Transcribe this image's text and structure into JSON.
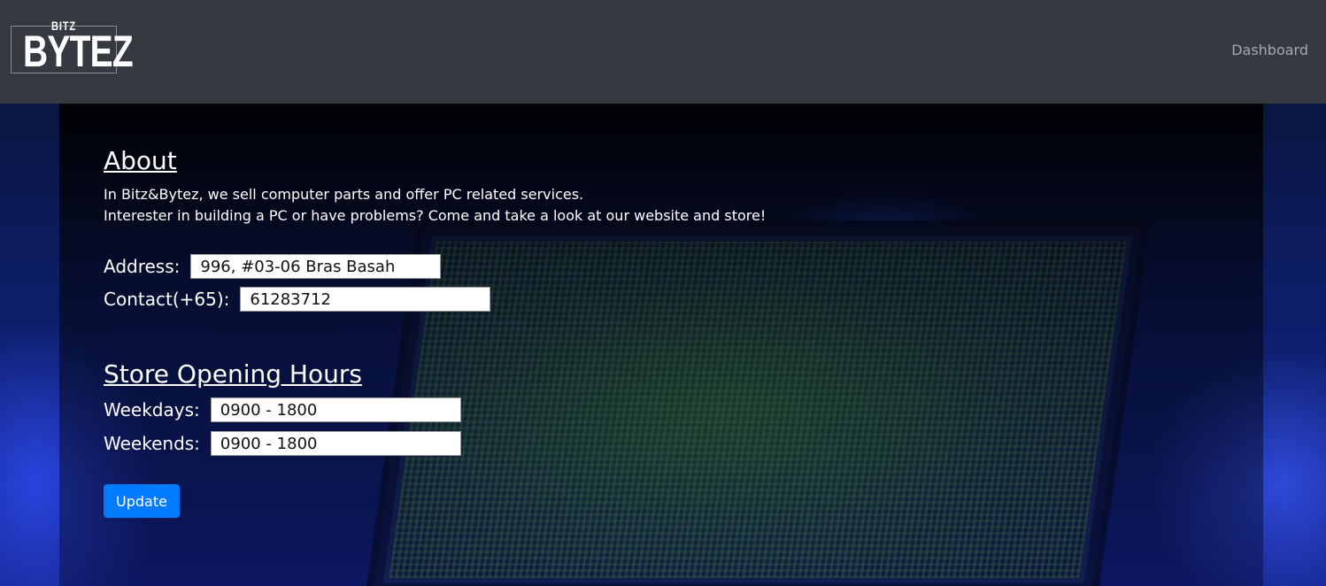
{
  "navbar": {
    "logo_top": "BITZ",
    "logo_main": "BYTEZ",
    "dashboard_link": "Dashboard"
  },
  "about": {
    "heading": "About",
    "line1": "In Bitz&Bytez, we sell computer parts and offer PC related services.",
    "line2": "Interester in building a PC or have problems? Come and take a look at our website and store!",
    "address_label": "Address:",
    "address_value": "996, #03-06 Bras Basah",
    "contact_label": "Contact(+65):",
    "contact_value": "61283712"
  },
  "hours": {
    "heading": "Store Opening Hours",
    "weekdays_label": "Weekdays:",
    "weekdays_value": "0900 - 1800",
    "weekends_label": "Weekends:",
    "weekends_value": "0900 - 1800"
  },
  "actions": {
    "update_label": "Update"
  },
  "colors": {
    "navbar_bg": "#343a40",
    "button_primary": "#007bff"
  }
}
